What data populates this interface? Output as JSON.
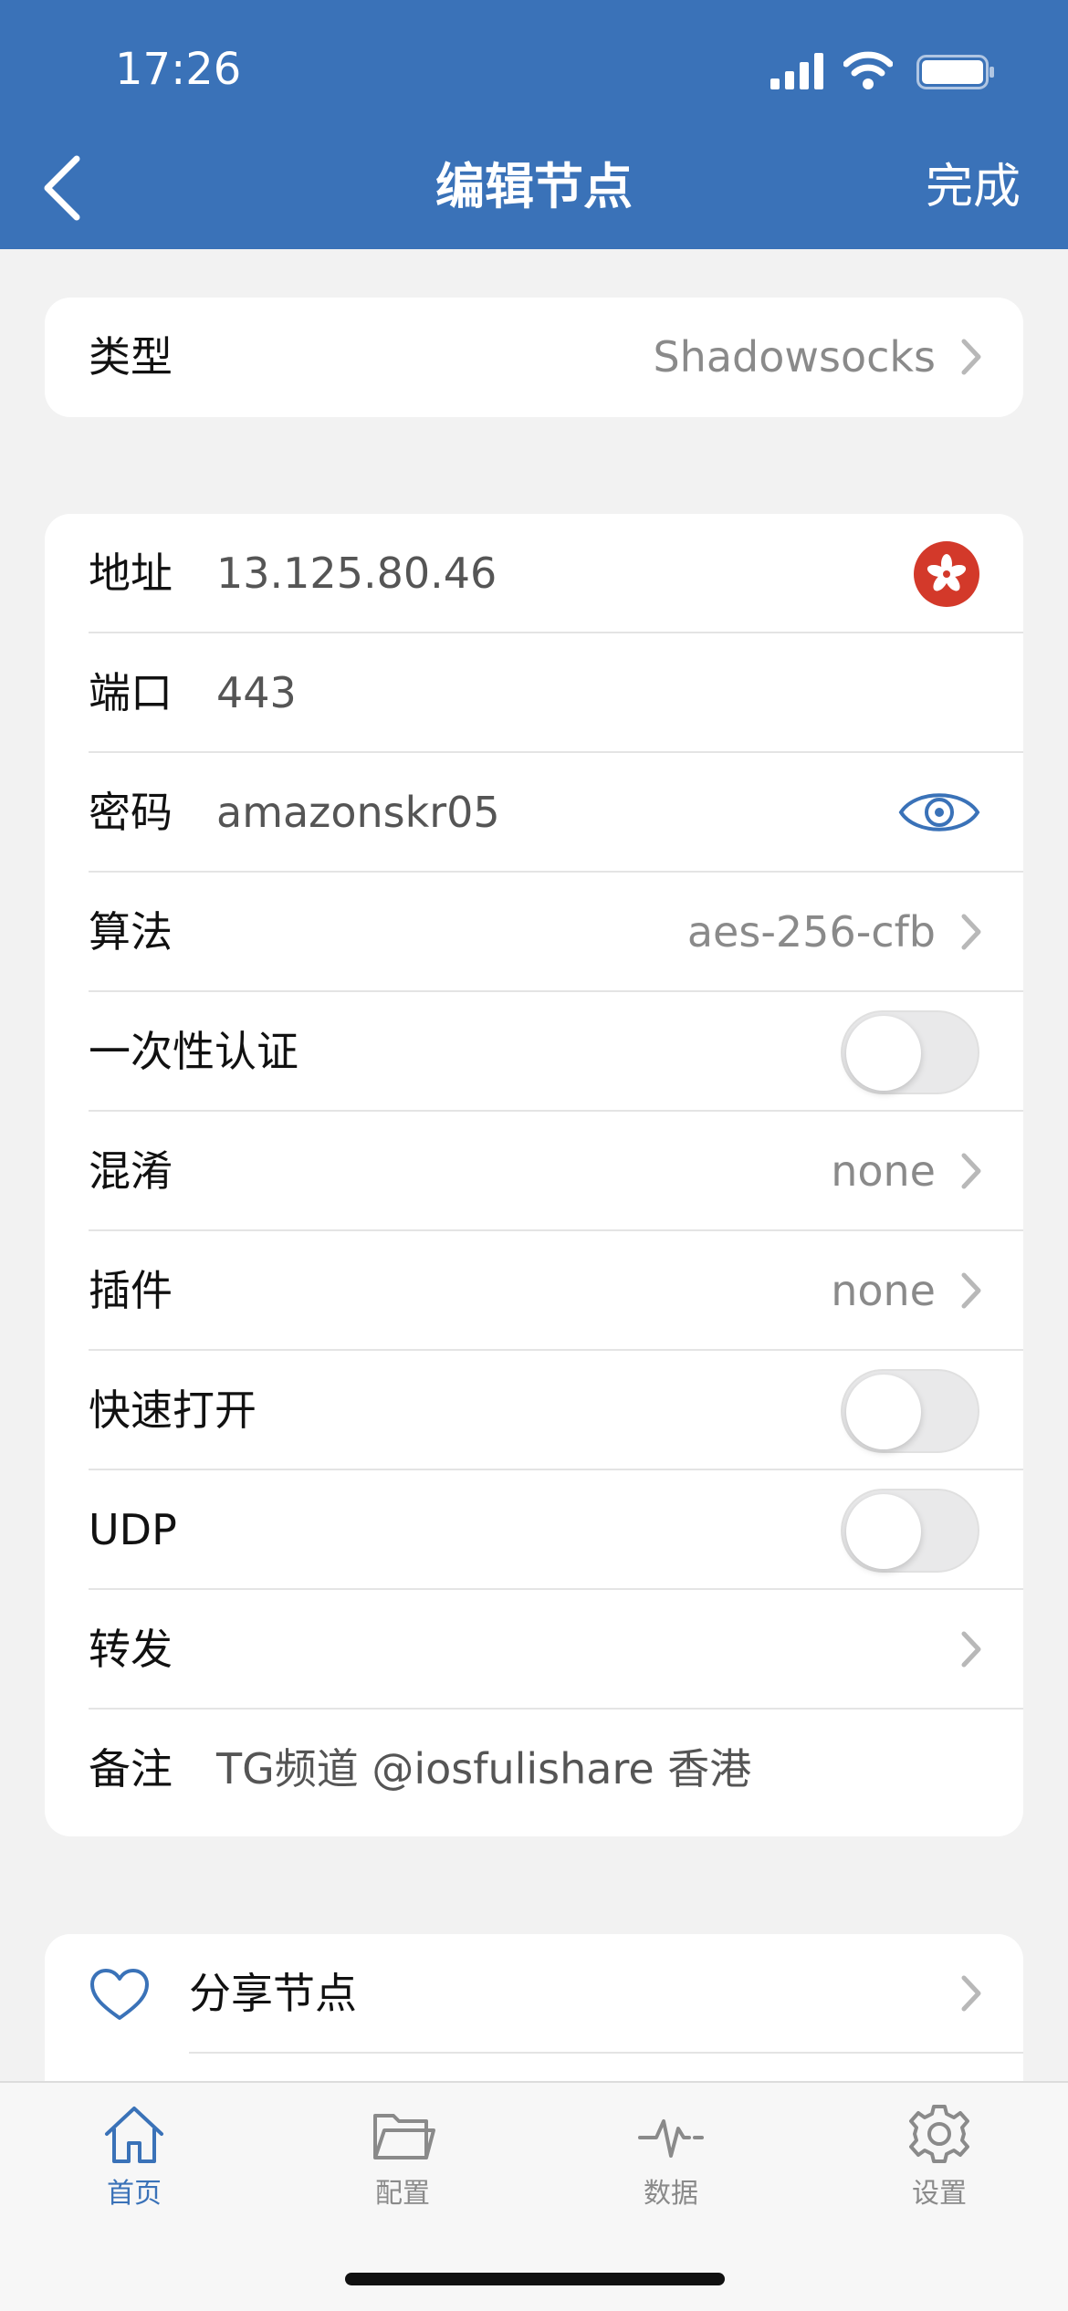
{
  "status": {
    "time": "17:26"
  },
  "nav": {
    "title": "编辑节点",
    "done_label": "完成"
  },
  "type_card": {
    "label": "类型",
    "value": "Shadowsocks"
  },
  "fields": {
    "address": {
      "label": "地址",
      "value": "13.125.80.46"
    },
    "port": {
      "label": "端口",
      "value": "443"
    },
    "password": {
      "label": "密码",
      "value": "amazonskr05"
    },
    "algorithm": {
      "label": "算法",
      "value": "aes-256-cfb"
    },
    "one_time_auth": {
      "label": "一次性认证",
      "on": false
    },
    "obfs": {
      "label": "混淆",
      "value": "none"
    },
    "plugin": {
      "label": "插件",
      "value": "none"
    },
    "fast_open": {
      "label": "快速打开",
      "on": false
    },
    "udp": {
      "label": "UDP",
      "on": false
    },
    "forward": {
      "label": "转发"
    },
    "note": {
      "label": "备注",
      "value": "TG频道 @iosfulishare 香港"
    }
  },
  "share": {
    "label": "分享节点"
  },
  "tabs": [
    {
      "label": "首页",
      "icon": "home-icon",
      "active": true
    },
    {
      "label": "配置",
      "icon": "folder-icon",
      "active": false
    },
    {
      "label": "数据",
      "icon": "pulse-icon",
      "active": false
    },
    {
      "label": "设置",
      "icon": "gear-icon",
      "active": false
    }
  ],
  "colors": {
    "accent": "#3a72b8",
    "flag": "#d3392a"
  }
}
